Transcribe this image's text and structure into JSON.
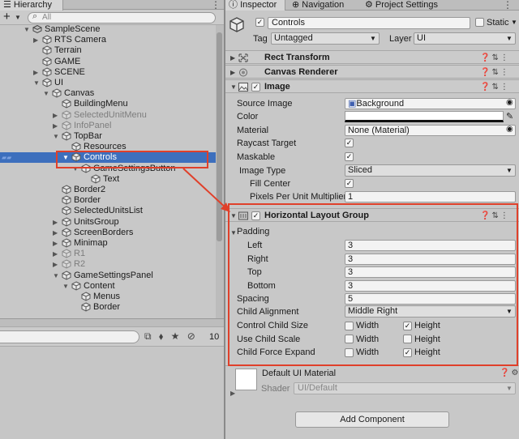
{
  "hierarchy": {
    "tab_label": "Hierarchy",
    "search_placeholder": "All",
    "items": [
      {
        "label": "SampleScene",
        "depth": 0,
        "arrow": "down",
        "icon": "scene",
        "dim": false,
        "selected": false
      },
      {
        "label": "RTS Camera",
        "depth": 1,
        "arrow": "right",
        "icon": "cube",
        "dim": false,
        "selected": false
      },
      {
        "label": "Terrain",
        "depth": 1,
        "arrow": "none",
        "icon": "cube",
        "dim": false,
        "selected": false
      },
      {
        "label": "GAME",
        "depth": 1,
        "arrow": "none",
        "icon": "cube",
        "dim": false,
        "selected": false
      },
      {
        "label": "SCENE",
        "depth": 1,
        "arrow": "right",
        "icon": "cube",
        "dim": false,
        "selected": false
      },
      {
        "label": "UI",
        "depth": 1,
        "arrow": "down",
        "icon": "cube",
        "dim": false,
        "selected": false
      },
      {
        "label": "Canvas",
        "depth": 2,
        "arrow": "down",
        "icon": "cube",
        "dim": false,
        "selected": false
      },
      {
        "label": "BuildingMenu",
        "depth": 3,
        "arrow": "none",
        "icon": "cube",
        "dim": false,
        "selected": false
      },
      {
        "label": "SelectedUnitMenu",
        "depth": 3,
        "arrow": "right",
        "icon": "cube",
        "dim": true,
        "selected": false
      },
      {
        "label": "InfoPanel",
        "depth": 3,
        "arrow": "right",
        "icon": "cube",
        "dim": true,
        "selected": false
      },
      {
        "label": "TopBar",
        "depth": 3,
        "arrow": "down",
        "icon": "cube",
        "dim": false,
        "selected": false
      },
      {
        "label": "Resources",
        "depth": 4,
        "arrow": "none",
        "icon": "cube",
        "dim": false,
        "selected": false
      },
      {
        "label": "Controls",
        "depth": 4,
        "arrow": "down",
        "icon": "cube",
        "dim": false,
        "selected": true
      },
      {
        "label": "GameSettingsButton",
        "depth": 5,
        "arrow": "down",
        "icon": "cube",
        "dim": false,
        "selected": false
      },
      {
        "label": "Text",
        "depth": 6,
        "arrow": "none",
        "icon": "cube",
        "dim": false,
        "selected": false
      },
      {
        "label": "Border2",
        "depth": 3,
        "arrow": "none",
        "icon": "cube",
        "dim": false,
        "selected": false
      },
      {
        "label": "Border",
        "depth": 3,
        "arrow": "none",
        "icon": "cube",
        "dim": false,
        "selected": false
      },
      {
        "label": "SelectedUnitsList",
        "depth": 3,
        "arrow": "none",
        "icon": "cube",
        "dim": false,
        "selected": false
      },
      {
        "label": "UnitsGroup",
        "depth": 3,
        "arrow": "right",
        "icon": "cube",
        "dim": false,
        "selected": false
      },
      {
        "label": "ScreenBorders",
        "depth": 3,
        "arrow": "right",
        "icon": "cube",
        "dim": false,
        "selected": false
      },
      {
        "label": "Minimap",
        "depth": 3,
        "arrow": "right",
        "icon": "cube",
        "dim": false,
        "selected": false
      },
      {
        "label": "R1",
        "depth": 3,
        "arrow": "right",
        "icon": "cube",
        "dim": true,
        "selected": false
      },
      {
        "label": "R2",
        "depth": 3,
        "arrow": "right",
        "icon": "cube",
        "dim": true,
        "selected": false
      },
      {
        "label": "GameSettingsPanel",
        "depth": 3,
        "arrow": "down",
        "icon": "cube",
        "dim": false,
        "selected": false
      },
      {
        "label": "Content",
        "depth": 4,
        "arrow": "down",
        "icon": "cube",
        "dim": false,
        "selected": false
      },
      {
        "label": "Menus",
        "depth": 5,
        "arrow": "none",
        "icon": "cube",
        "dim": false,
        "selected": false
      },
      {
        "label": "Border",
        "depth": 5,
        "arrow": "none",
        "icon": "cube",
        "dim": false,
        "selected": false
      }
    ]
  },
  "project": {
    "hidden_count": "10"
  },
  "inspector": {
    "tabs": [
      "Inspector",
      "Navigation",
      "Project Settings"
    ],
    "object_name": "Controls",
    "active": true,
    "static_label": "Static",
    "tag_label": "Tag",
    "tag_value": "Untagged",
    "layer_label": "Layer",
    "layer_value": "UI",
    "rect_transform": "Rect Transform",
    "canvas_renderer": "Canvas Renderer",
    "image": {
      "title": "Image",
      "source_image_label": "Source Image",
      "source_image_value": "Background",
      "color_label": "Color",
      "color_value": "#ffffff",
      "material_label": "Material",
      "material_value": "None (Material)",
      "raycast_label": "Raycast Target",
      "maskable_label": "Maskable",
      "image_type_label": "Image Type",
      "image_type_value": "Sliced",
      "fill_center_label": "Fill Center",
      "ppu_label": "Pixels Per Unit Multiplier",
      "ppu_value": "1"
    },
    "hlg": {
      "title": "Horizontal Layout Group",
      "padding_label": "Padding",
      "left_label": "Left",
      "left_value": "3",
      "right_label": "Right",
      "right_value": "3",
      "top_label": "Top",
      "top_value": "3",
      "bottom_label": "Bottom",
      "bottom_value": "3",
      "spacing_label": "Spacing",
      "spacing_value": "5",
      "child_alignment_label": "Child Alignment",
      "child_alignment_value": "Middle Right",
      "control_child_size_label": "Control Child Size",
      "use_child_scale_label": "Use Child Scale",
      "child_force_expand_label": "Child Force Expand",
      "width_label": "Width",
      "height_label": "Height",
      "control_width": false,
      "control_height": true,
      "scale_width": false,
      "scale_height": false,
      "expand_width": false,
      "expand_height": true
    },
    "material": {
      "name": "Default UI Material",
      "shader_label": "Shader",
      "shader_value": "UI/Default"
    },
    "add_component": "Add Component"
  },
  "colors": {
    "selection": "#3d6fbd",
    "annotation": "#e0402a"
  }
}
